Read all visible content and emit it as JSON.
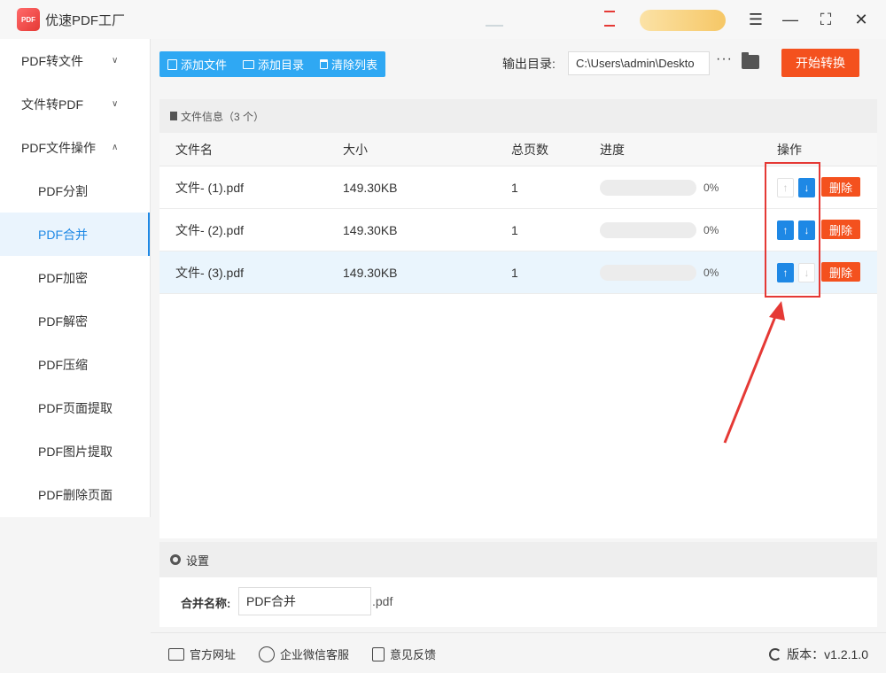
{
  "app": {
    "title": "优速PDF工厂",
    "logo_text": "PDF"
  },
  "window_controls": {
    "menu": "☰",
    "minimize": "—",
    "maximize": "⛶",
    "close": "✕"
  },
  "sidebar": {
    "groups": [
      {
        "label": "PDF转文件",
        "chevron": "∨"
      },
      {
        "label": "文件转PDF",
        "chevron": "∨"
      },
      {
        "label": "PDF文件操作",
        "chevron": "∧"
      }
    ],
    "items": [
      {
        "label": "PDF分割"
      },
      {
        "label": "PDF合并",
        "active": true
      },
      {
        "label": "PDF加密"
      },
      {
        "label": "PDF解密"
      },
      {
        "label": "PDF压缩"
      },
      {
        "label": "PDF页面提取"
      },
      {
        "label": "PDF图片提取"
      },
      {
        "label": "PDF删除页面"
      }
    ]
  },
  "toolbar": {
    "add_file": "添加文件",
    "add_folder": "添加目录",
    "clear_list": "清除列表",
    "output_label": "输出目录:",
    "output_path": "C:\\Users\\admin\\Deskto",
    "more": "···",
    "start": "开始转换"
  },
  "file_panel": {
    "header": "文件信息（3 个）",
    "columns": {
      "name": "文件名",
      "size": "大小",
      "pages": "总页数",
      "progress": "进度",
      "ops": "操作"
    },
    "rows": [
      {
        "name": "文件- (1).pdf",
        "size": "149.30KB",
        "pages": "1",
        "progress_pct": "0%",
        "progress_value": 0,
        "up_enabled": false,
        "down_enabled": true,
        "delete": "删除"
      },
      {
        "name": "文件- (2).pdf",
        "size": "149.30KB",
        "pages": "1",
        "progress_pct": "0%",
        "progress_value": 0,
        "up_enabled": true,
        "down_enabled": true,
        "delete": "删除"
      },
      {
        "name": "文件- (3).pdf",
        "size": "149.30KB",
        "pages": "1",
        "progress_pct": "0%",
        "progress_value": 0,
        "up_enabled": true,
        "down_enabled": false,
        "delete": "删除",
        "selected": true
      }
    ],
    "arrow_up": "↑",
    "arrow_down": "↓"
  },
  "settings": {
    "header": "设置",
    "merge_label": "合并名称:",
    "merge_name": "PDF合并",
    "merge_ext": ".pdf"
  },
  "footer": {
    "website": "官方网址",
    "wechat": "企业微信客服",
    "feedback": "意见反馈",
    "version": "版本：v1.2.1.0"
  },
  "colors": {
    "accent_blue": "#1e88e5",
    "toolbar_blue": "#2fa8f3",
    "danger_orange": "#f4511e",
    "annotation_red": "#e53935"
  }
}
